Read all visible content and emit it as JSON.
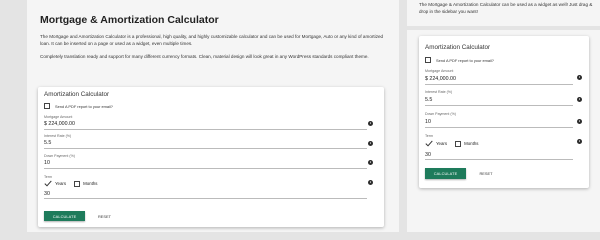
{
  "page": {
    "title": "Mortgage & Amortization Calculator",
    "intro_p1": "The Mortgage and Amortization Calculator is a professional, high quality, and highly customizable calculator and can be used for Mortgage, Auto or any kind of amortized loan.   It can be inserted on a page or used as a widget, even multiple times.",
    "intro_p2": "Completely translation ready and support for many different currency formats.  Clean, material design will look great in any WordPress standards compliant theme."
  },
  "sidebar": {
    "note": "The Mortgage & Amortization Calculator can be used as a widget as well! Just drag & drop in the sidebar you want!"
  },
  "calculator": {
    "title": "Amortization Calculator",
    "pdf_label": "Send A PDF report to your email?",
    "fields": [
      {
        "label": "Mortgage Amount",
        "value": "$ 224,000.00"
      },
      {
        "label": "Interest Rate (%)",
        "value": "5.5"
      },
      {
        "label": "Down Payment (%)",
        "value": "10"
      },
      {
        "label": "Term",
        "value": "30"
      }
    ],
    "term_options": {
      "years": "Years",
      "months": "Months",
      "years_checked": true,
      "months_checked": false
    },
    "calculate_label": "CALCULATE",
    "reset_label": "RESET",
    "info_glyph": "i",
    "colors": {
      "button": "#1e7b5b",
      "card_bg": "#ffffff"
    }
  }
}
